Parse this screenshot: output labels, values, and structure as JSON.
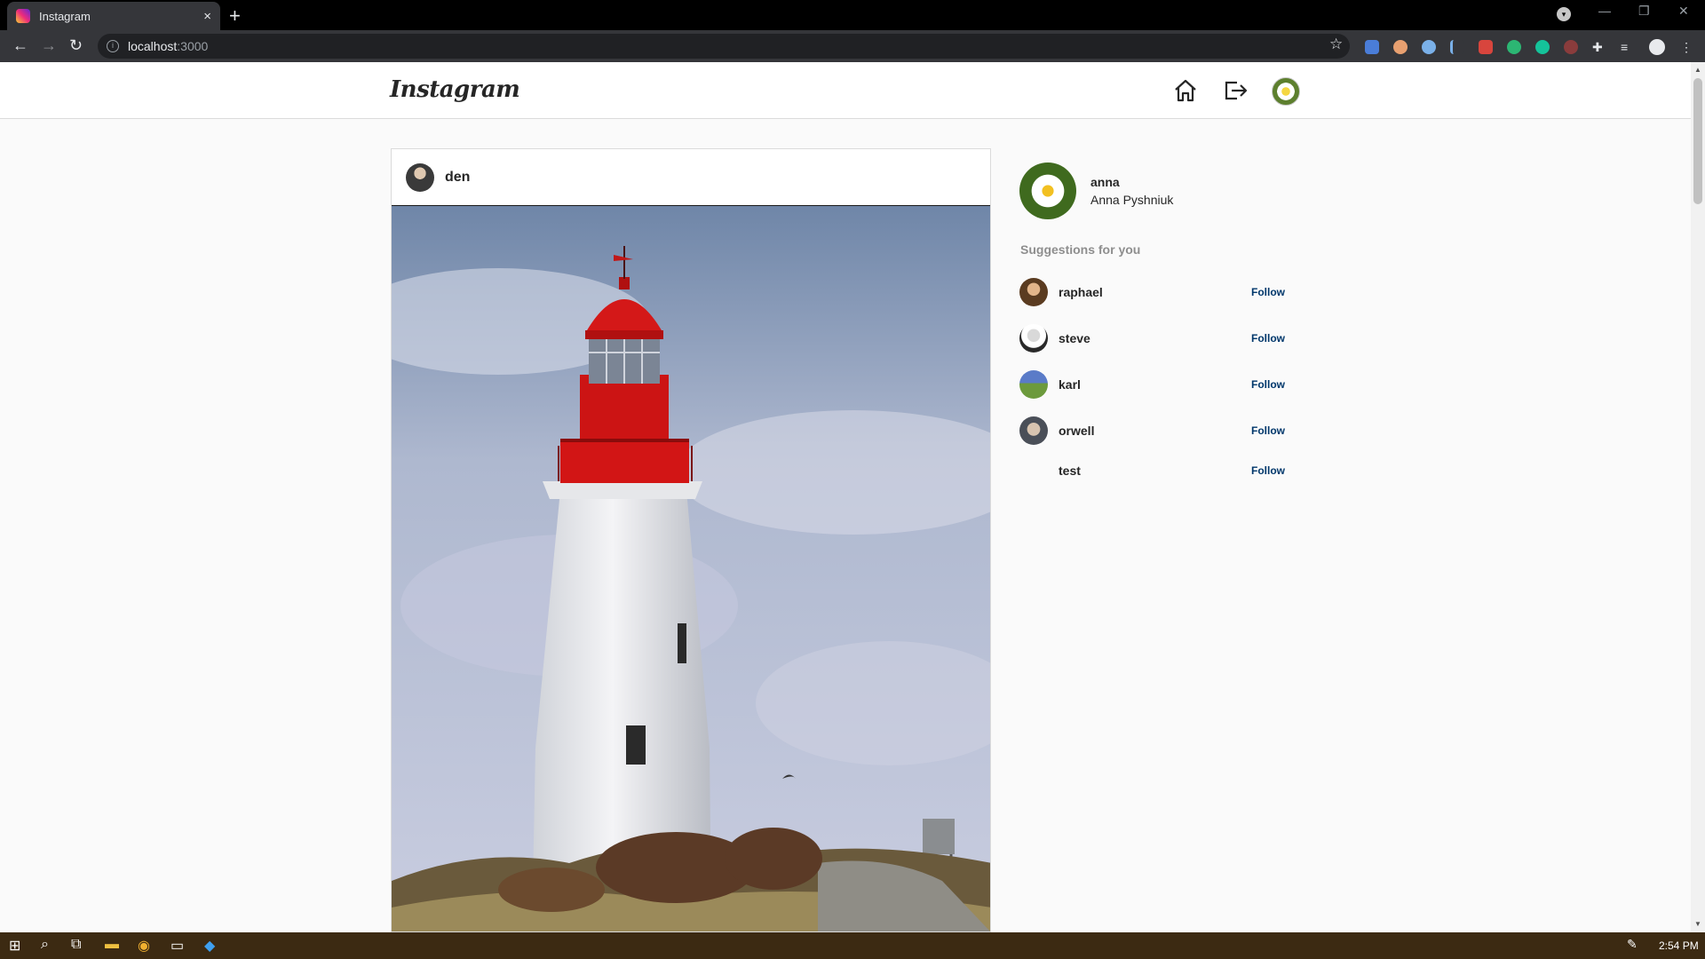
{
  "browser": {
    "tab_title": "Instagram",
    "new_tab": "+",
    "close": "×",
    "url_host": "localhost",
    "url_port": ":3000"
  },
  "header": {
    "logo": "Instagram"
  },
  "post": {
    "username": "den"
  },
  "sidebar": {
    "username": "anna",
    "full_name": "Anna Pyshniuk",
    "suggestions_title": "Suggestions for you",
    "suggestions": [
      {
        "name": "raphael",
        "action": "Follow"
      },
      {
        "name": "steve",
        "action": "Follow"
      },
      {
        "name": "karl",
        "action": "Follow"
      },
      {
        "name": "orwell",
        "action": "Follow"
      },
      {
        "name": "test",
        "action": "Follow"
      }
    ]
  },
  "taskbar": {
    "time": "2:54 PM"
  },
  "colors": {
    "follow": "#00376b",
    "lighthouse_red": "#c81010",
    "taskbar": "#3c2a12"
  }
}
